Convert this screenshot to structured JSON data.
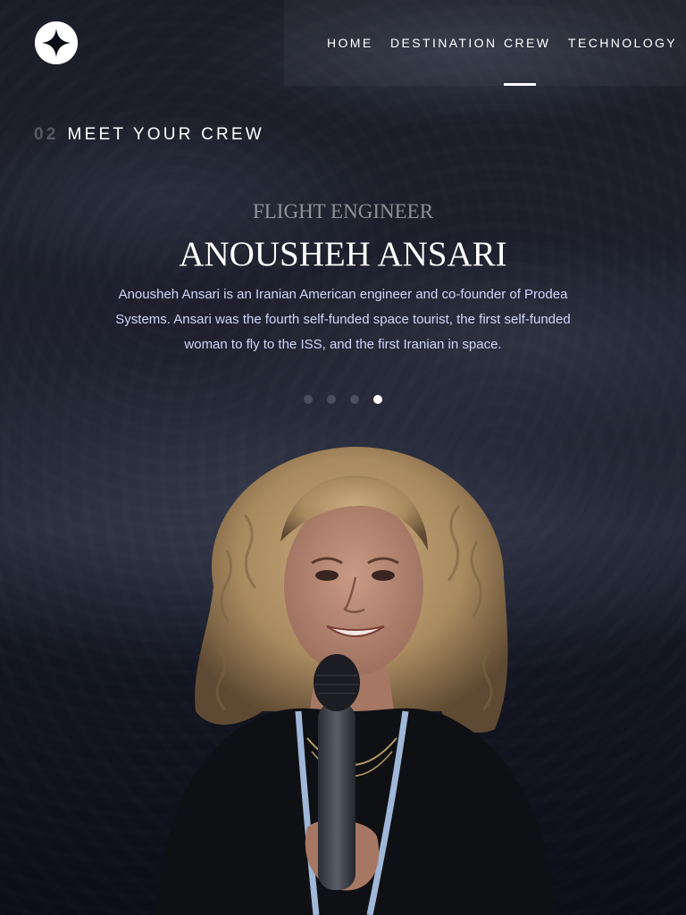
{
  "nav": {
    "logo_icon": "star-logo-icon",
    "items": [
      {
        "label": "HOME",
        "active": false
      },
      {
        "label": "DESTINATION",
        "active": false
      },
      {
        "label": "CREW",
        "active": true
      },
      {
        "label": "TECHNOLOGY",
        "active": false
      }
    ]
  },
  "page": {
    "number": "02",
    "title": "MEET YOUR CREW"
  },
  "crew": {
    "role": "FLIGHT ENGINEER",
    "name": "ANOUSHEH ANSARI",
    "bio": "Anousheh Ansari is an Iranian American engineer and co-founder of Prodea Systems. Ansari was the fourth self-funded space tourist, the first self-funded woman to fly to the ISS, and the first Iranian in space.",
    "slides_total": 4,
    "active_slide": 4
  },
  "colors": {
    "background": "#0b0d17",
    "text": "#ffffff",
    "body_text": "#d0d6f9"
  }
}
